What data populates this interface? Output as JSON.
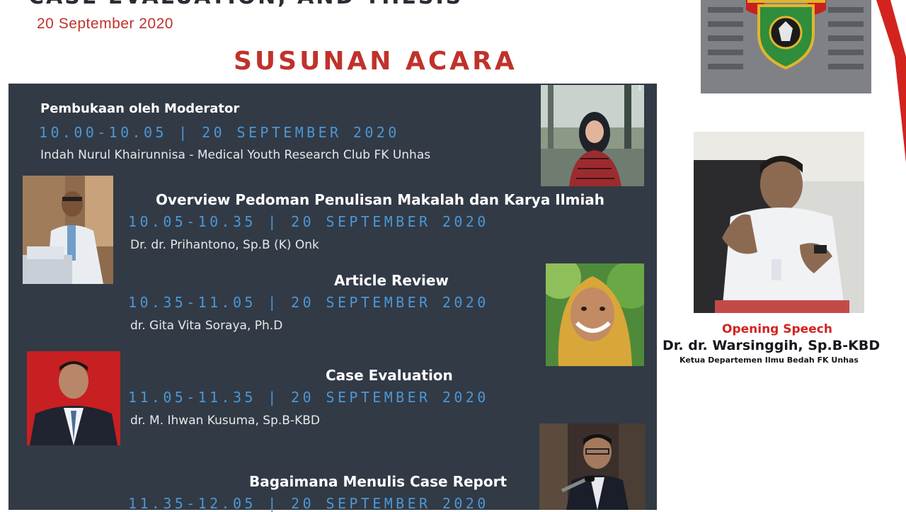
{
  "header": {
    "top_title": "CASE EVALUATION, AND THESIS",
    "date": "20 September 2020",
    "agenda_title": "SUSUNAN ACARA"
  },
  "agenda": [
    {
      "title": "Pembukaan oleh Moderator",
      "time": "10.00-10.05 | 20 SEPTEMBER 2020",
      "speaker": "Indah Nurul Khairunnisa - Medical Youth Research Club FK Unhas"
    },
    {
      "title": "Overview Pedoman Penulisan Makalah dan Karya Ilmiah",
      "time": "10.05-10.35 | 20 SEPTEMBER 2020",
      "speaker": "Dr. dr. Prihantono, Sp.B (K) Onk"
    },
    {
      "title": "Article Review",
      "time": "10.35-11.05 | 20 SEPTEMBER 2020",
      "speaker": "dr. Gita Vita Soraya, Ph.D"
    },
    {
      "title": "Case Evaluation",
      "time": "11.05-11.35 | 20 SEPTEMBER 2020",
      "speaker": "dr. M. Ihwan Kusuma, Sp.B-KBD"
    },
    {
      "title": "Bagaimana Menulis Case Report",
      "time": "11.35-12.05 | 20 SEPTEMBER 2020",
      "speaker": ""
    }
  ],
  "opening": {
    "label": "Opening Speech",
    "name": "Dr. dr. Warsinggih, Sp.B-KBD",
    "role": "Ketua Departemen Ilmu Bedah FK Unhas"
  },
  "colors": {
    "panel": "#323a45",
    "accent_red": "#c0322b",
    "time_blue": "#4b97d6"
  }
}
